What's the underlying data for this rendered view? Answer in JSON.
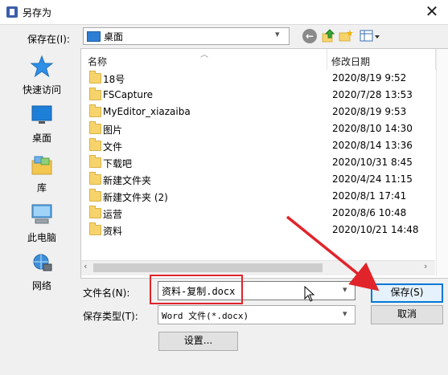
{
  "window": {
    "title": "另存为"
  },
  "toolbar": {
    "save_in_label": "保存在(I):",
    "location": "桌面"
  },
  "nav": [
    {
      "label": "快速访问",
      "icon": "star-icon"
    },
    {
      "label": "桌面",
      "icon": "desktop-icon"
    },
    {
      "label": "库",
      "icon": "library-icon"
    },
    {
      "label": "此电脑",
      "icon": "computer-icon"
    },
    {
      "label": "网络",
      "icon": "network-icon"
    }
  ],
  "columns": {
    "name": "名称",
    "modified": "修改日期"
  },
  "files": [
    {
      "name": "18号",
      "date": "2020/8/19 9:52"
    },
    {
      "name": "FSCapture",
      "date": "2020/7/28 13:53"
    },
    {
      "name": "MyEditor_xiazaiba",
      "date": "2020/8/19 9:53"
    },
    {
      "name": "图片",
      "date": "2020/8/10 14:30"
    },
    {
      "name": "文件",
      "date": "2020/8/14 13:36"
    },
    {
      "name": "下载吧",
      "date": "2020/10/31 8:45"
    },
    {
      "name": "新建文件夹",
      "date": "2020/4/24 11:15"
    },
    {
      "name": "新建文件夹 (2)",
      "date": "2020/8/1 17:41"
    },
    {
      "name": "运营",
      "date": "2020/8/6 10:48"
    },
    {
      "name": "资料",
      "date": "2020/10/21 14:48"
    }
  ],
  "form": {
    "filename_label": "文件名(N):",
    "filename_value": "资料-复制.docx",
    "type_label": "保存类型(T):",
    "type_value": "Word 文件(*.docx)",
    "save_label": "保存(S)",
    "cancel_label": "取消",
    "settings_label": "设置..."
  },
  "colors": {
    "highlight": "#e0242a",
    "accent": "#0078d7",
    "folder": "#f7d36b"
  }
}
